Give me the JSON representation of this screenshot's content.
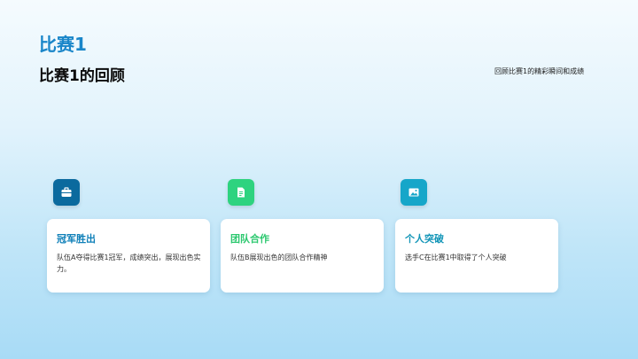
{
  "header": {
    "title": "比赛1",
    "heading": "比赛1的回顾",
    "subtitle": "回顾比赛1的精彩瞬间和成绩"
  },
  "cards": [
    {
      "icon": "briefcase-icon",
      "color": "#0b6a9e",
      "title": "冠军胜出",
      "title_color": "#0e7fb8",
      "desc": "队伍A夺得比赛1冠军，成绩突出，展现出色实力。"
    },
    {
      "icon": "document-icon",
      "color": "#2ed37f",
      "title": "团队合作",
      "title_color": "#2cc86f",
      "desc": "队伍B展现出色的团队合作精神"
    },
    {
      "icon": "image-icon",
      "color": "#16a6c9",
      "title": "个人突破",
      "title_color": "#1496b8",
      "desc": "选手C在比赛1中取得了个人突破"
    }
  ]
}
